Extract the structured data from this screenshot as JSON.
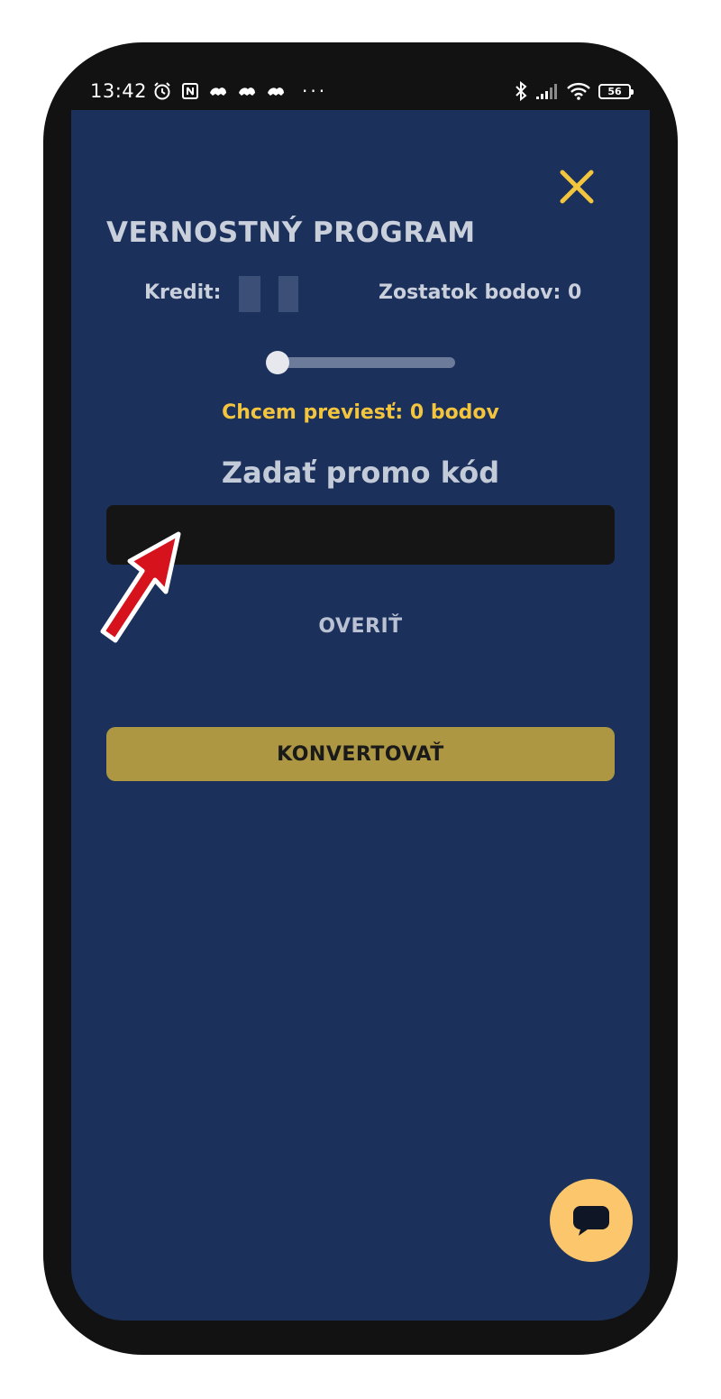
{
  "status_bar": {
    "time": "13:42",
    "battery": "56",
    "left_icons": [
      "alarm-icon",
      "nfc-icon",
      "app-notification-icon",
      "app-notification-icon",
      "app-notification-icon"
    ],
    "more": "···",
    "right_icons": [
      "bluetooth-icon",
      "signal-icon",
      "wifi-icon",
      "battery-icon"
    ]
  },
  "dialog": {
    "title": "VERNOSTNÝ PROGRAM",
    "credit_label": "Kredit:",
    "balance_label": "Zostatok bodov: 0",
    "slider": {
      "value": 0,
      "min": 0
    },
    "transfer_text": "Chcem previesť: 0 bodov",
    "promo_label": "Zadať promo kód",
    "promo_value": "",
    "verify_label": "OVERIŤ",
    "convert_label": "KONVERTOVAŤ",
    "close_icon": "close-icon",
    "chat_icon": "chat-bubble-icon"
  },
  "colors": {
    "screen_bg": "#1b305b",
    "accent_yellow": "#f3c53f",
    "convert_button": "#ad9742",
    "chat_button": "#fcc76c",
    "input_bg": "#151515",
    "annotation_arrow": "#d6121c"
  }
}
